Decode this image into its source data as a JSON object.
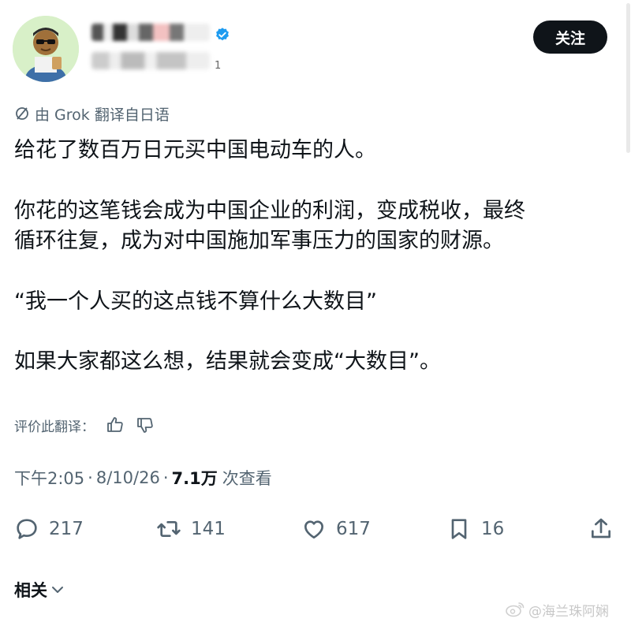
{
  "header": {
    "follow_label": "关注",
    "handle_suffix": "1"
  },
  "translation": {
    "label": "由 Grok 翻译自日语"
  },
  "tweet": {
    "line1": "给花了数百万日元买中国电动车的人。",
    "line2": "你花的这笔钱会成为中国企业的利润，变成税收，最终",
    "line3": "循环往复，成为对中国施加军事压力的国家的财源。",
    "line4": "“我一个人买的这点钱不算什么大数目”",
    "line5": "如果大家都这么想，结果就会变成“大数目”。"
  },
  "rate": {
    "label": "评价此翻译："
  },
  "meta": {
    "time": "下午2:05",
    "dot": "·",
    "date": "8/10/26",
    "views_count": "7.1万",
    "views_label": "次查看"
  },
  "actions": {
    "replies": "217",
    "reposts": "141",
    "likes": "617",
    "bookmarks": "16"
  },
  "related": {
    "label": "相关"
  },
  "watermark": {
    "text": "@海兰珠阿娴"
  },
  "icons": {
    "translate": "grok-icon",
    "verified": "verified-badge-icon",
    "thumbs_up": "thumbs-up-icon",
    "thumbs_down": "thumbs-down-icon",
    "reply": "reply-icon",
    "repost": "repost-icon",
    "like": "heart-icon",
    "bookmark": "bookmark-icon",
    "share": "share-icon",
    "chevron": "chevron-down-icon",
    "weibo": "weibo-icon"
  },
  "colors": {
    "text": "#0f1419",
    "secondary": "#536471",
    "verified": "#1d9bf0",
    "follow_bg": "#0f1419"
  }
}
